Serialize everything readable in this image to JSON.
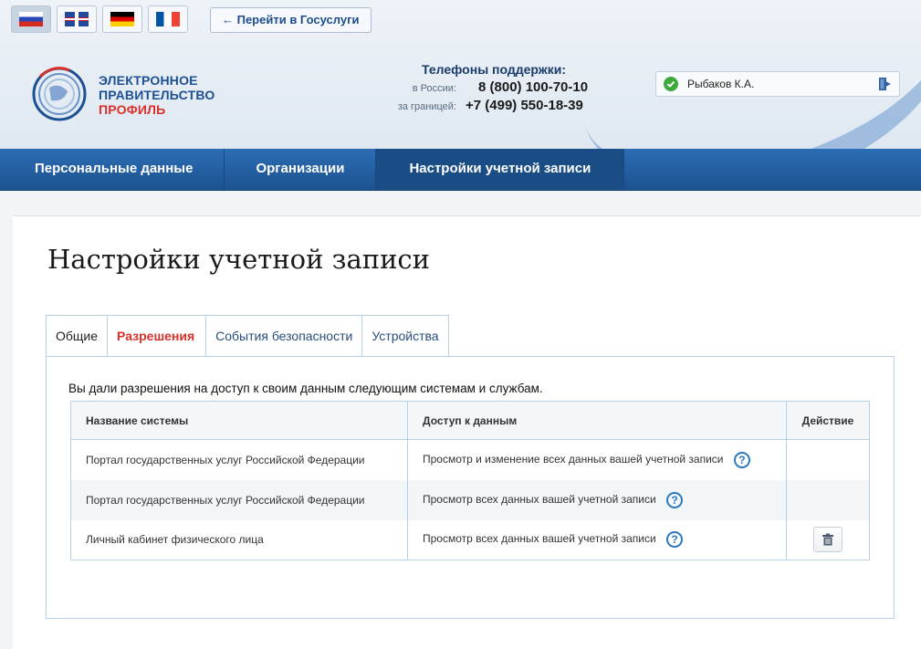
{
  "languages": [
    {
      "code": "ru",
      "active": true
    },
    {
      "code": "uk",
      "active": false
    },
    {
      "code": "de",
      "active": false
    },
    {
      "code": "fr",
      "active": false
    }
  ],
  "header": {
    "gosuslugi_link": "← Перейти в Госуслуги",
    "logo_line1": "ЭЛЕКТРОННОЕ",
    "logo_line2": "ПРАВИТЕЛЬСТВО",
    "logo_line3": "ПРОФИЛЬ",
    "phones_title": "Телефоны поддержки:",
    "phone_ru_label": "в России:",
    "phone_ru": "8 (800) 100-70-10",
    "phone_abroad_label": "за границей:",
    "phone_abroad": "+7 (499) 550-18-39",
    "user_name": "Рыбаков К.А."
  },
  "nav": {
    "items": [
      "Персональные данные",
      "Организации",
      "Настройки учетной записи"
    ],
    "active_index": 2
  },
  "main": {
    "title": "Настройки учетной записи",
    "tabs": [
      "Общие",
      "Разрешения",
      "События безопасности",
      "Устройства"
    ],
    "active_tab": 1,
    "intro": "Вы дали разрешения на доступ к своим данным следующим системам и службам.",
    "table": {
      "headers": [
        "Название системы",
        "Доступ к данным",
        "Действие"
      ],
      "rows": [
        {
          "system": "Портал государственных услуг Российской Федерации",
          "access": "Просмотр и изменение всех данных вашей учетной записи",
          "deletable": false
        },
        {
          "system": "Портал государственных услуг Российской Федерации",
          "access": "Просмотр всех данных вашей учетной записи",
          "deletable": false
        },
        {
          "system": "Личный кабинет физического лица",
          "access": "Просмотр всех данных вашей учетной записи",
          "deletable": true
        }
      ]
    }
  },
  "colors": {
    "nav_blue": "#2c6db4",
    "accent_red": "#d9302c",
    "link_blue": "#1b4d8c",
    "border_blue": "#b8d0e6",
    "success_green": "#3da93d"
  },
  "icons": {
    "help": "?",
    "user_status": "check-icon",
    "logout": "logout-icon",
    "delete": "trash-icon"
  }
}
